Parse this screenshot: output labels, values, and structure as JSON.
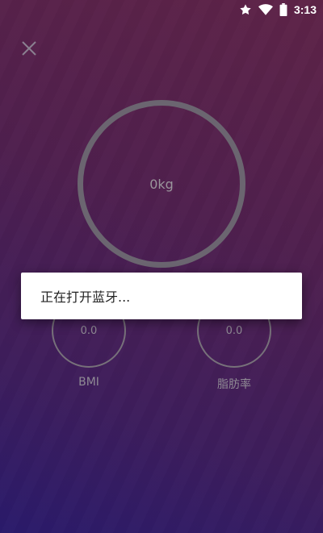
{
  "status_bar": {
    "time": "3:13",
    "icons": [
      "star-icon",
      "wifi-icon",
      "battery-icon"
    ],
    "color": "#ffffff"
  },
  "close_icon": "close-icon",
  "weight": {
    "value": "0kg"
  },
  "metrics": [
    {
      "value": "0.0",
      "label": "BMI"
    },
    {
      "value": "0.0",
      "label": "脂肪率"
    }
  ],
  "dialog": {
    "message": "正在打开蓝牙..."
  },
  "colors": {
    "background_top": "#5e2347",
    "background_bottom": "#2a1a6b",
    "ring": "#6b6570",
    "dialog_bg": "#ffffff"
  }
}
